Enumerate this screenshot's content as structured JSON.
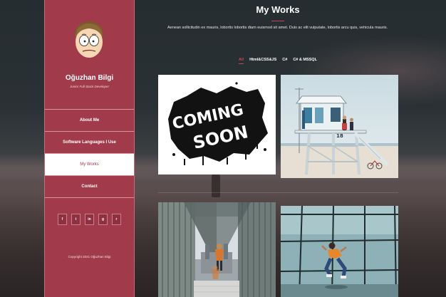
{
  "sidebar": {
    "name": "Oğuzhan Bilgi",
    "role": "Junior Full Stack Developer",
    "nav": [
      {
        "label": "About Me"
      },
      {
        "label": "Software Languages I Use"
      },
      {
        "label": "My Works",
        "active": true
      },
      {
        "label": "Contact"
      }
    ],
    "socials": [
      {
        "icon": "facebook-icon",
        "glyph": "f"
      },
      {
        "icon": "twitter-icon",
        "glyph": "t"
      },
      {
        "icon": "linkedin-icon",
        "glyph": "in"
      },
      {
        "icon": "github-icon",
        "glyph": "g"
      },
      {
        "icon": "rss-icon",
        "glyph": "r"
      }
    ],
    "copyright": "Copyright 2021 Oğuzhan Bilgi"
  },
  "main": {
    "title": "My Works",
    "lead": "Aenean sollicitudin ex mauris, lobortis lobortis diam euismod sit amet. Duis ac elit vulputate, lobortis arcu quis, vehicula mauris.",
    "filters": [
      {
        "label": "All",
        "active": true
      },
      {
        "label": "Html&CSS&JS"
      },
      {
        "label": "C#"
      },
      {
        "label": "C# & MSSQL"
      }
    ],
    "works": [
      {
        "name": "coming-soon",
        "text_line1": "COMING",
        "text_line2": "SOON"
      },
      {
        "name": "lifeguard-tower",
        "tower_number": "18"
      },
      {
        "name": "mirror-building"
      },
      {
        "name": "glass-wall-jump"
      }
    ]
  },
  "colors": {
    "accent": "#a13a4b",
    "accent_line": "#c0485b"
  }
}
